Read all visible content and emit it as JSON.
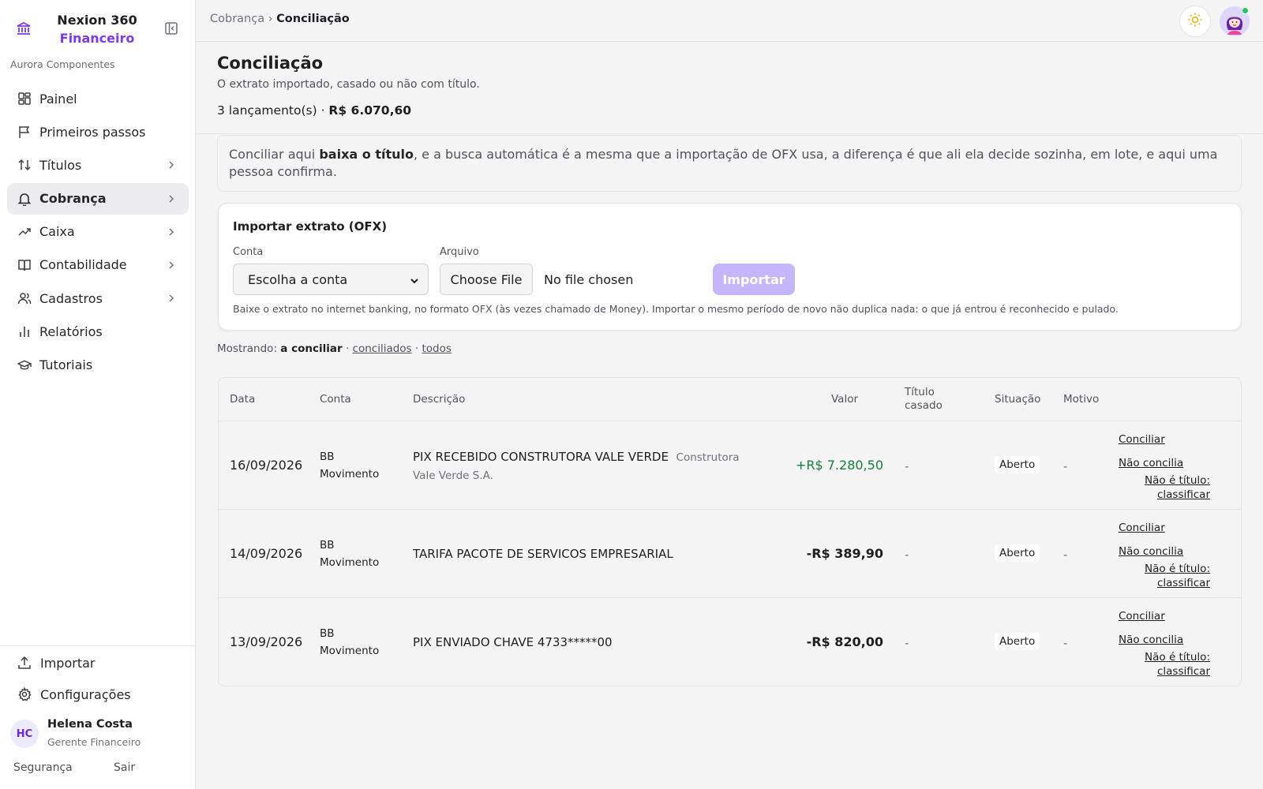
{
  "brand": {
    "line1": "Nexion 360",
    "line2": "Financeiro",
    "org": "Aurora Componentes"
  },
  "nav": [
    {
      "label": "Painel",
      "icon": "grid-icon",
      "chevron": false,
      "active": false
    },
    {
      "label": "Primeiros passos",
      "icon": "flag-icon",
      "chevron": false,
      "active": false
    },
    {
      "label": "Títulos",
      "icon": "arrows-up-down-icon",
      "chevron": true,
      "active": false
    },
    {
      "label": "Cobrança",
      "icon": "bell-icon",
      "chevron": true,
      "active": true
    },
    {
      "label": "Caixa",
      "icon": "trending-up-icon",
      "chevron": true,
      "active": false
    },
    {
      "label": "Contabilidade",
      "icon": "book-open-icon",
      "chevron": true,
      "active": false
    },
    {
      "label": "Cadastros",
      "icon": "users-icon",
      "chevron": true,
      "active": false
    },
    {
      "label": "Relatórios",
      "icon": "bar-chart-icon",
      "chevron": false,
      "active": false
    },
    {
      "label": "Tutoriais",
      "icon": "graduation-cap-icon",
      "chevron": false,
      "active": false
    }
  ],
  "sidebar_bottom": {
    "import_label": "Importar",
    "settings_label": "Configurações",
    "user_initials": "HC",
    "user_name": "Helena Costa",
    "user_role": "Gerente Financeiro",
    "security_label": "Segurança",
    "exit_label": "Sair"
  },
  "topbar": {
    "crumb_parent": "Cobrança",
    "crumb_sep": "›",
    "crumb_current": "Conciliação"
  },
  "page": {
    "title": "Conciliação",
    "subtitle": "O extrato importado, casado ou não com título.",
    "summary_count": "3 lançamento(s) ·",
    "summary_total": "R$ 6.070,60"
  },
  "hint": {
    "before": "Conciliar aqui ",
    "bold": "baixa o título",
    "after": ", e a busca automática é a mesma que a importação de OFX usa, a diferença é que ali ela decide sozinha, em lote, e aqui uma pessoa confirma."
  },
  "import": {
    "title": "Importar extrato (OFX)",
    "account_label": "Conta",
    "account_value": "Escolha a conta",
    "file_label": "Arquivo",
    "file_button": "Choose File",
    "file_status": "No file chosen",
    "import_button": "Importar",
    "help": "Baixe o extrato no internet banking, no formato OFX (às vezes chamado de Money). Importar o mesmo período de novo não duplica nada: o que já entrou é reconhecido e pulado."
  },
  "filter": {
    "prefix": "Mostrando:",
    "current": "a conciliar",
    "sep": "·",
    "opt1": "conciliados",
    "opt2": "todos"
  },
  "table": {
    "headers": {
      "date": "Data",
      "account": "Conta",
      "description": "Descrição",
      "value": "Valor",
      "title_l1": "Título",
      "title_l2": "casado",
      "status": "Situação",
      "reason": "Motivo"
    },
    "actions": {
      "reconcile": "Conciliar",
      "not_reconcile": "Não concilia",
      "classify_l1": "Não é título:",
      "classify_l2": "classificar"
    },
    "rows": [
      {
        "date": "16/09/2026",
        "acc1": "BB",
        "acc2": "Movimento",
        "desc": "PIX RECEBIDO CONSTRUTORA VALE VERDE",
        "counterpart": "Construtora Vale Verde S.A.",
        "value": "+R$ 7.280,50",
        "title": "-",
        "status": "Aberto",
        "reason": "-"
      },
      {
        "date": "14/09/2026",
        "acc1": "BB",
        "acc2": "Movimento",
        "desc": "TARIFA PACOTE DE SERVICOS EMPRESARIAL",
        "counterpart": "",
        "value": "-R$ 389,90",
        "title": "-",
        "status": "Aberto",
        "reason": "-"
      },
      {
        "date": "13/09/2026",
        "acc1": "BB",
        "acc2": "Movimento",
        "desc": "PIX ENVIADO CHAVE 4733*****00",
        "counterpart": "",
        "value": "-R$ 820,00",
        "title": "-",
        "status": "Aberto",
        "reason": "-"
      }
    ]
  },
  "colors": {
    "brand_accent": "#7c3aed",
    "import_button": "#c4b5fd",
    "positive_value": "#15803d",
    "online": "#22c55e"
  }
}
